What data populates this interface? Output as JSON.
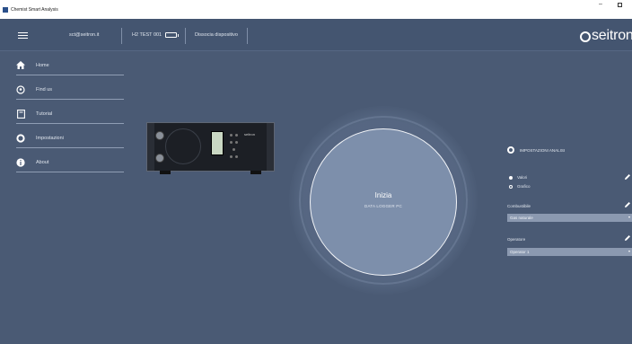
{
  "window": {
    "title": "Chemist Smart Analysis"
  },
  "topbar": {
    "user": "sct@seitron.it",
    "device_name": "H2 TEST 001",
    "disconnect_label": "Dissocia dispositivo",
    "brand": "seitron"
  },
  "sidebar": {
    "items": [
      {
        "label": "Home",
        "icon": "home-icon"
      },
      {
        "label": "Find us",
        "icon": "location-pin-icon"
      },
      {
        "label": "Tutorial",
        "icon": "book-icon"
      },
      {
        "label": "Impostazioni",
        "icon": "settings-ring-icon"
      },
      {
        "label": "About",
        "icon": "info-icon"
      }
    ]
  },
  "device": {
    "brand": "seitron"
  },
  "main": {
    "start_title": "Inizia",
    "start_subtitle": "DATA LOGGER PC"
  },
  "settings": {
    "title": "IMPOSTAZIONI ANALISI",
    "view_options": [
      {
        "label": "Valori",
        "selected": true
      },
      {
        "label": "Grafico",
        "selected": false
      }
    ],
    "fuel_label": "Combustibile",
    "fuel_value": "Gas naturale",
    "operator_label": "Operatore",
    "operator_value": "Operator 1"
  },
  "colors": {
    "background": "#4a5a74",
    "topbar": "#445570",
    "start_button": "#7d8fab",
    "select_bg": "#8b99b0"
  }
}
